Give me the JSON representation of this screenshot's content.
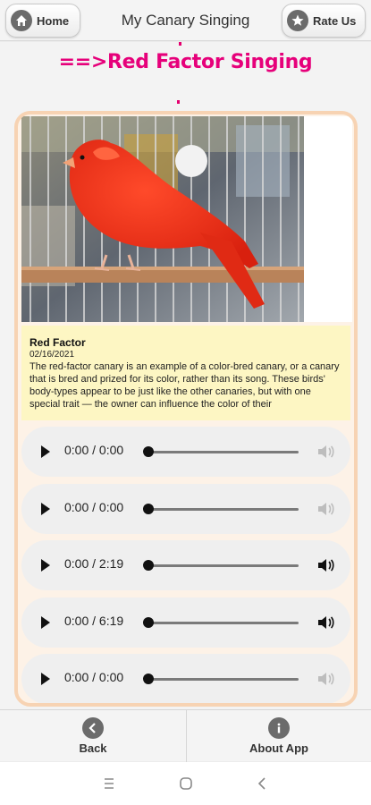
{
  "header": {
    "home_label": "Home",
    "title": "My Canary Singing",
    "rate_label": "Rate Us"
  },
  "banner": {
    "text": "==>Red Factor Singing"
  },
  "article": {
    "title": "Red Factor",
    "date": "02/16/2021",
    "body": "The red-factor canary is an example of a color-bred canary, or a canary that is bred and prized for its color, rather than its song. These birds' body-types appear to be just like the other canaries, but with one special trait — the owner can influence the color of their"
  },
  "players": [
    {
      "time": "0:00 / 0:00",
      "progress": 0,
      "volume_active": false
    },
    {
      "time": "0:00 / 0:00",
      "progress": 0,
      "volume_active": false
    },
    {
      "time": "0:00 / 2:19",
      "progress": 0,
      "volume_active": true
    },
    {
      "time": "0:00 / 6:19",
      "progress": 0,
      "volume_active": true
    },
    {
      "time": "0:00 / 0:00",
      "progress": 0,
      "volume_active": false
    }
  ],
  "bottom_bar": {
    "back_label": "Back",
    "about_label": "About App"
  },
  "colors": {
    "accent": "#e6007a",
    "card_border": "#f7d3b3",
    "description_bg": "#fdf6c3"
  },
  "icons": {
    "home": "home-icon",
    "rate": "star-icon",
    "back": "arrow-left-icon",
    "about": "info-icon",
    "play": "play-icon",
    "volume": "speaker-icon",
    "recents": "recents-icon",
    "home_nav": "home-circle-icon",
    "back_nav": "chevron-left-icon"
  }
}
